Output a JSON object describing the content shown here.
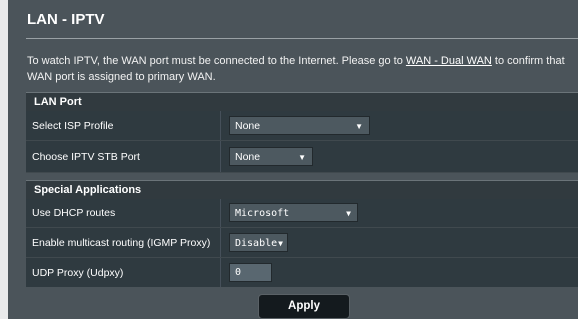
{
  "page": {
    "title": "LAN - IPTV",
    "description_prefix": "To watch IPTV, the WAN port must be connected to the Internet. Please go to ",
    "description_link": "WAN - Dual WAN",
    "description_suffix": " to confirm that WAN port is assigned to primary WAN."
  },
  "lan_port": {
    "heading": "LAN Port",
    "isp_profile_label": "Select ISP Profile",
    "isp_profile_value": "None",
    "stb_port_label": "Choose IPTV STB Port",
    "stb_port_value": "None"
  },
  "special_apps": {
    "heading": "Special Applications",
    "dhcp_routes_label": "Use DHCP routes",
    "dhcp_routes_value": "Microsoft",
    "igmp_label": "Enable multicast routing (IGMP Proxy)",
    "igmp_value": "Disable",
    "udpxy_label": "UDP Proxy (Udpxy)",
    "udpxy_value": "0"
  },
  "actions": {
    "apply_label": "Apply"
  },
  "icons": {
    "dropdown": "chevron-down-icon",
    "caret_glyph": "▼"
  },
  "colors": {
    "panel": "#4b545a",
    "section_header": "#313a3f",
    "row": "#2f3a40",
    "button": "#141a1e"
  }
}
